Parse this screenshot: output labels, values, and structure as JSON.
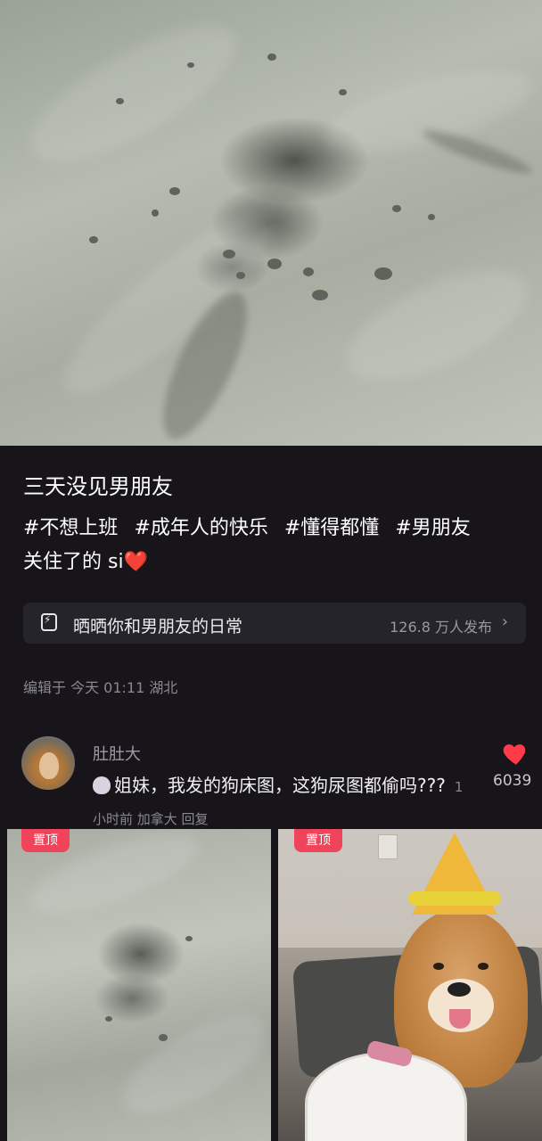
{
  "post": {
    "title": "三天没见男朋友",
    "tags": [
      "#不想上班",
      "#成年人的快乐",
      "#懂得都懂",
      "#男朋友"
    ],
    "caption": "关住了的 si",
    "caption_emoji": "❤️"
  },
  "topic": {
    "icon": "lightning-square-icon",
    "text": "晒晒你和男朋友的日常",
    "count": "126.8 万人发布",
    "arrow": "›"
  },
  "edit_info": "编辑于 今天 01:11 湖北",
  "comment": {
    "username": "肚肚大",
    "emoji": "poop-emoji",
    "text": "姐妹，我发的狗床图，这狗尿图都偷吗???",
    "meta": "1小时前 加拿大 回复",
    "likes": "6039"
  },
  "thumbnails": [
    {
      "badge": "置顶"
    },
    {
      "badge": "置顶"
    }
  ],
  "colors": {
    "background": "#17151a",
    "like_heart": "#ff3b4a",
    "pin_badge": "#f0445a"
  }
}
